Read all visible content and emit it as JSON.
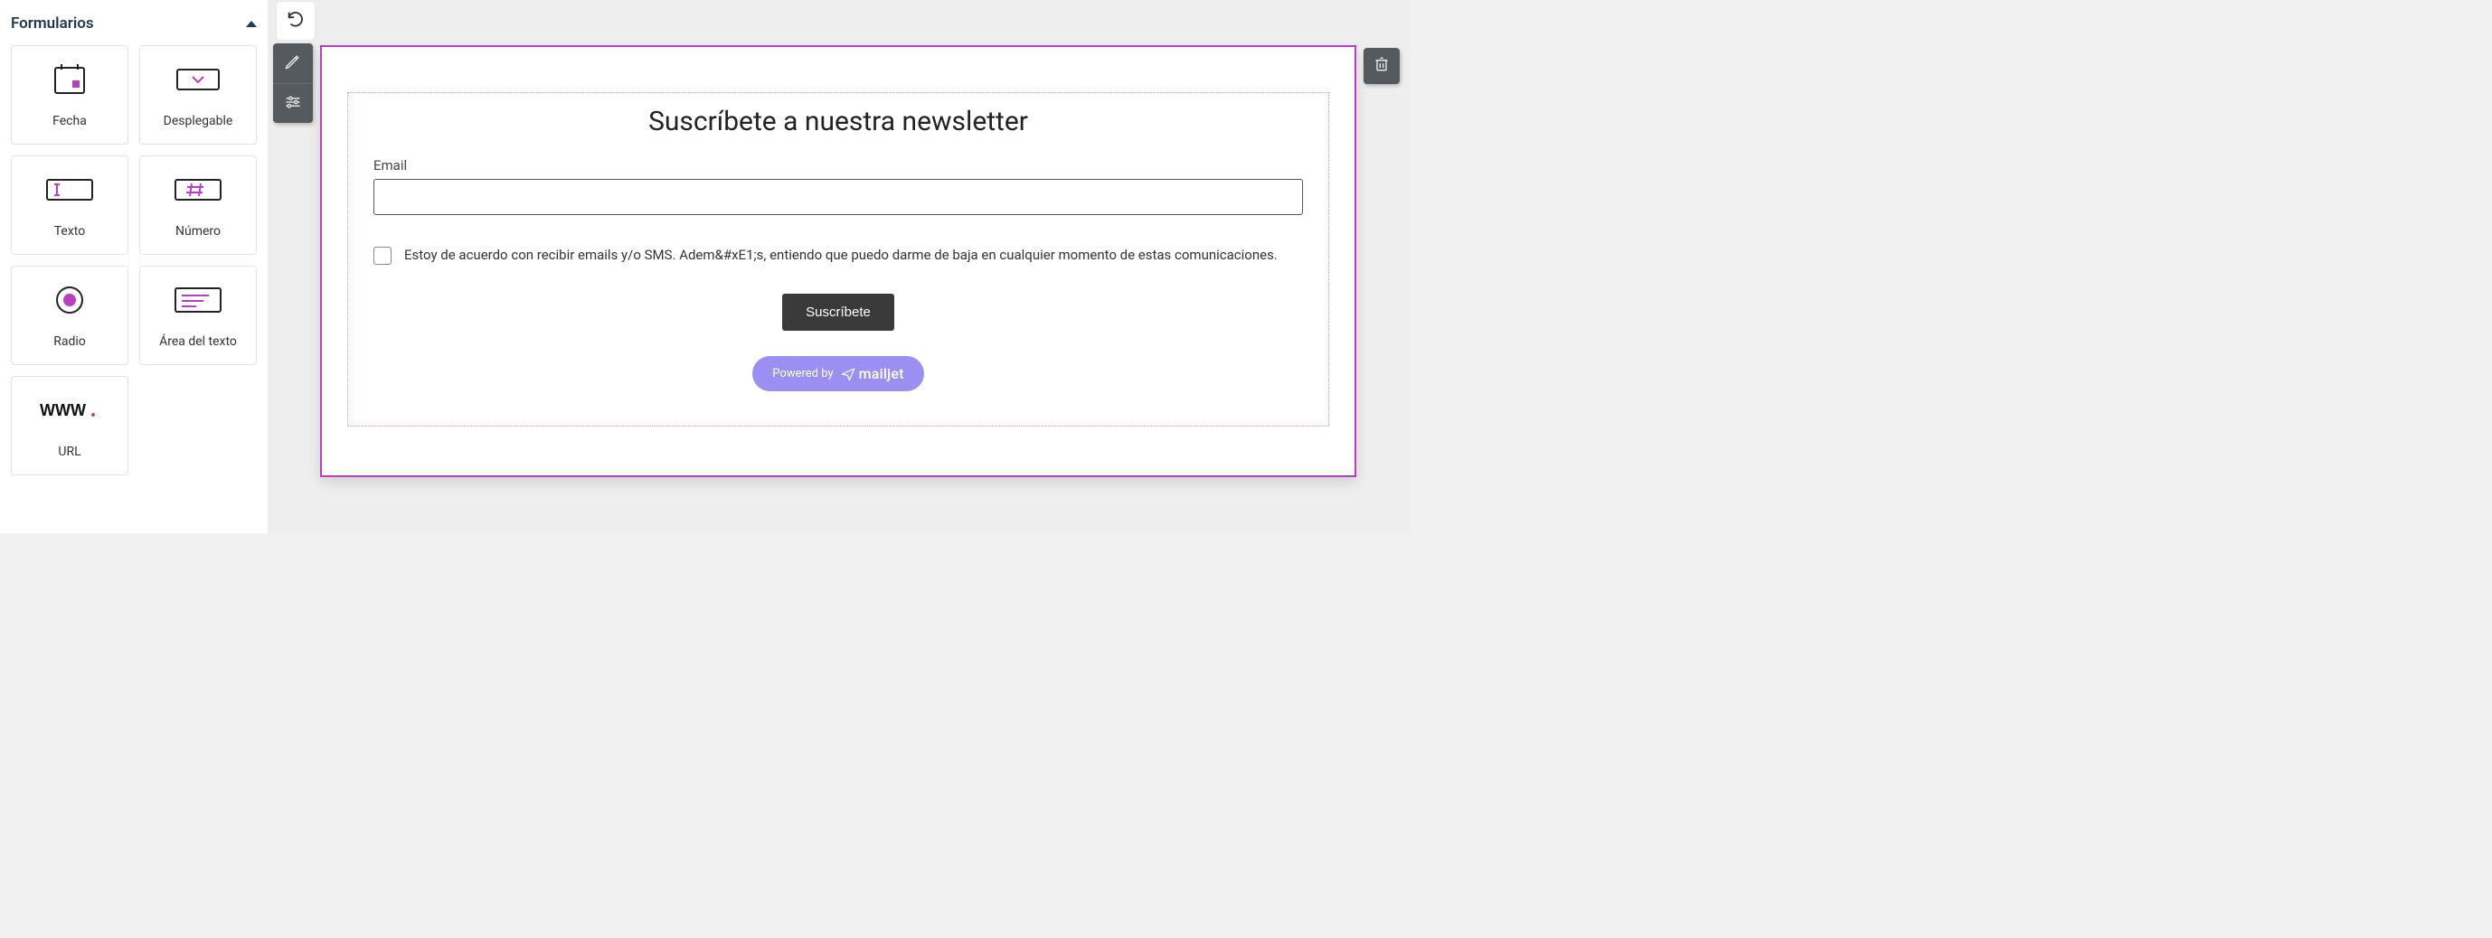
{
  "sidebar": {
    "title": "Formularios",
    "items": [
      {
        "label": "Fecha",
        "icon": "date"
      },
      {
        "label": "Desplegable",
        "icon": "dropdown"
      },
      {
        "label": "Texto",
        "icon": "text"
      },
      {
        "label": "Número",
        "icon": "number"
      },
      {
        "label": "Radio",
        "icon": "radio"
      },
      {
        "label": "Área del texto",
        "icon": "textarea"
      },
      {
        "label": "URL",
        "icon": "url"
      }
    ]
  },
  "form": {
    "title": "Suscríbete a nuestra newsletter",
    "email_label": "Email",
    "email_value": "",
    "consent_text": "Estoy de acuerdo con recibir emails y/o SMS. Adem&#xE1;s, entiendo que puedo darme de baja en cualquier momento de estas comunicaciones.",
    "submit_label": "Suscríbete",
    "powered_by_prefix": "Powered by",
    "powered_by_brand": "mailjet"
  },
  "colors": {
    "accent": "#b93ec1",
    "sidebar_title": "#1a3a52",
    "pill": "#9b8ff2",
    "toolbar": "#555a5e",
    "submit": "#3a3a3a"
  }
}
